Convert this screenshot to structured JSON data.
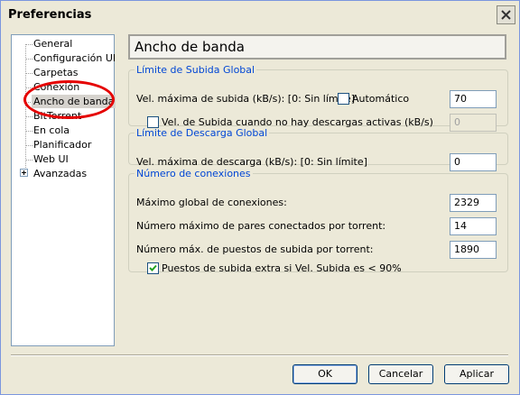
{
  "window": {
    "title": "Preferencias"
  },
  "sidebar": {
    "items": [
      {
        "label": "General"
      },
      {
        "label": "Configuración UI"
      },
      {
        "label": "Carpetas"
      },
      {
        "label": "Conexión"
      },
      {
        "label": "Ancho de banda",
        "selected": true
      },
      {
        "label": "BitTorrent"
      },
      {
        "label": "En cola"
      },
      {
        "label": "Planificador"
      },
      {
        "label": "Web UI"
      },
      {
        "label": "Avanzadas",
        "expandable": true
      }
    ]
  },
  "main": {
    "section_title": "Ancho de banda",
    "upload_group": {
      "legend": "Límite de Subida Global",
      "max_upload_label": "Vel. máxima de subida (kB/s): [0: Sin límite]",
      "auto_label": "Automático",
      "auto_checked": false,
      "max_upload_value": "70",
      "no_download_label": "Vel. de Subida cuando no hay descargas activas (kB/s)",
      "no_download_checked": false,
      "no_download_value": "0"
    },
    "download_group": {
      "legend": "Límite de Descarga Global",
      "max_download_label": "Vel. máxima de descarga (kB/s): [0: Sin límite]",
      "max_download_value": "0"
    },
    "connections_group": {
      "legend": "Número de conexiones",
      "global_max_label": "Máximo global de conexiones:",
      "global_max_value": "2329",
      "peers_label": "Número máximo de pares conectados por torrent:",
      "peers_value": "14",
      "slots_label": "Número máx. de puestos de subida por torrent:",
      "slots_value": "1890",
      "extra_slots_label": "Puestos de subida extra si Vel. Subida es < 90%",
      "extra_slots_checked": true
    }
  },
  "buttons": {
    "ok": "OK",
    "cancel": "Cancelar",
    "apply": "Aplicar"
  },
  "colors": {
    "accent": "#0046d5",
    "annotation": "#e50000",
    "window_bg": "#ece9d8"
  }
}
